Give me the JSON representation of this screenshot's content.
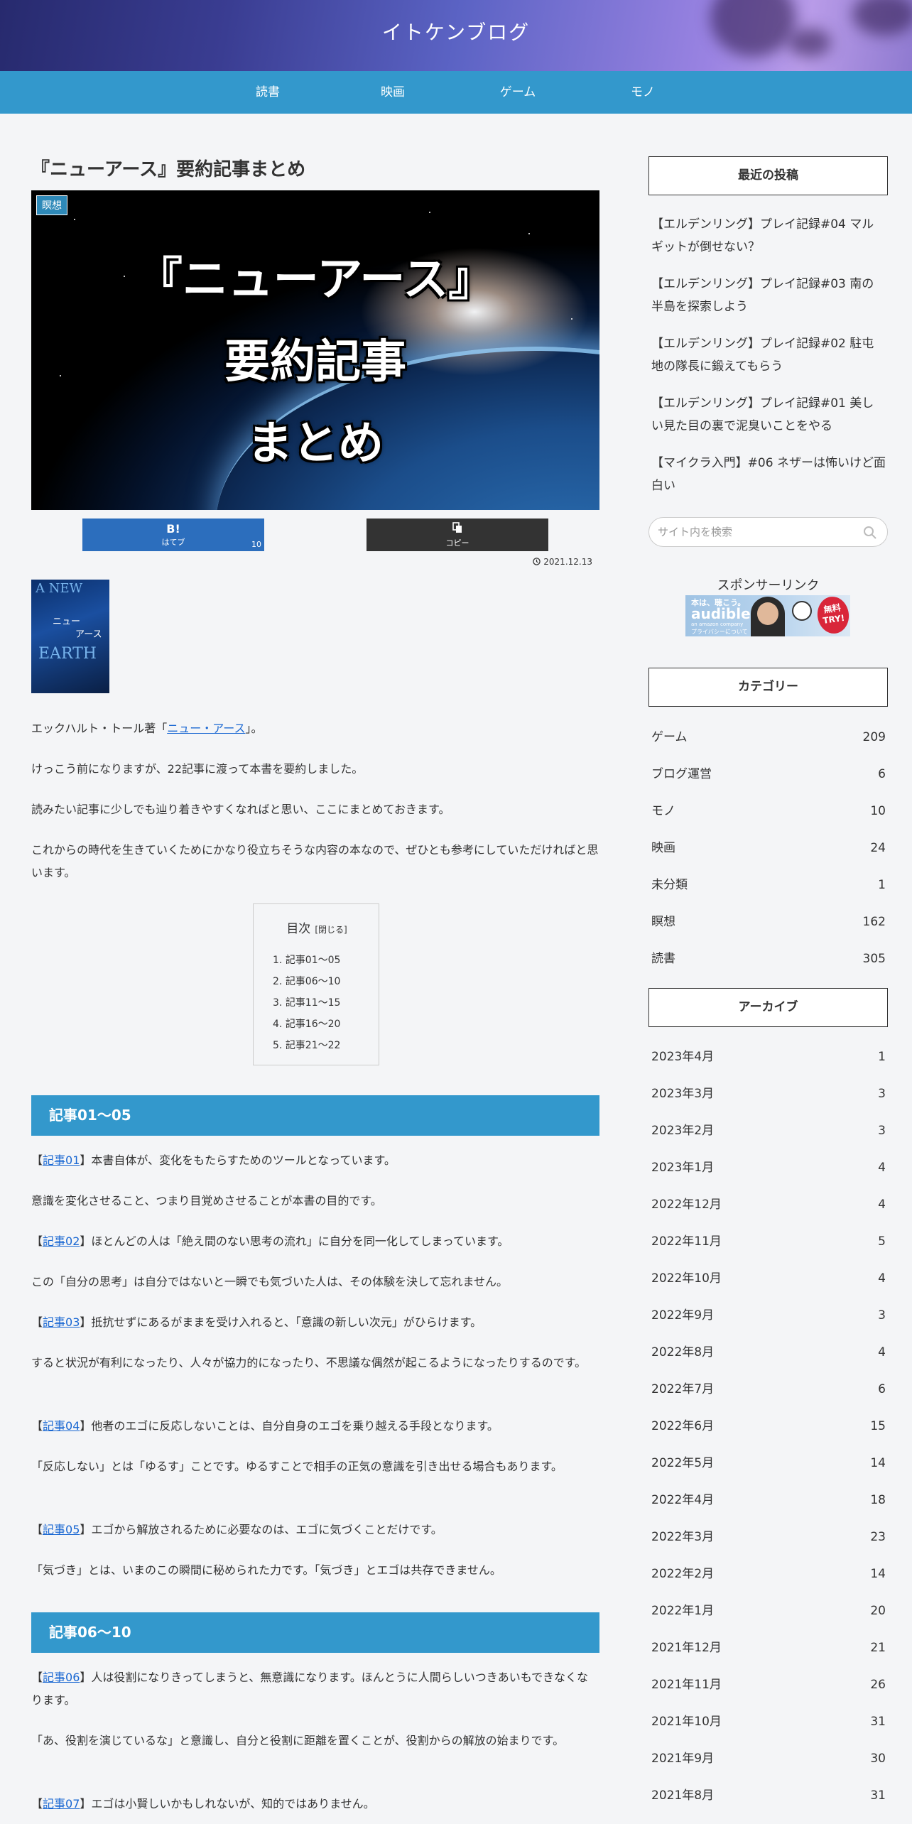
{
  "site": {
    "title": "イトケンブログ"
  },
  "nav": [
    "読書",
    "映画",
    "ゲーム",
    "モノ"
  ],
  "article": {
    "title": "『ニューアース』要約記事まとめ",
    "category": "瞑想",
    "eyecatch_lines": [
      "『ニューアース』",
      "要約記事",
      "まとめ"
    ],
    "share": {
      "hatena_icon": "B!",
      "hatena_label": "はてブ",
      "hatena_count": "10",
      "copy_label": "コピー"
    },
    "date": "2021.12.13",
    "book_cover": {
      "en_top": "A NEW",
      "en_bottom": "EARTH",
      "jp_line1": "ニュー",
      "jp_line2": "アース"
    },
    "intro": {
      "pre": "エックハルト・トール著「",
      "link": "ニュー・アース",
      "post": "」。"
    },
    "paragraphs": [
      "けっこう前になりますが、22記事に渡って本書を要約しました。",
      "読みたい記事に少しでも辿り着きやすくなればと思い、ここにまとめておきます。",
      "これからの時代を生きていくためにかなり役立ちそうな内容の本なので、ぜひとも参考にしていただければと思います。"
    ],
    "toc": {
      "title": "目次",
      "toggle": "[閉じる]",
      "items": [
        "記事01〜05",
        "記事06〜10",
        "記事11〜15",
        "記事16〜20",
        "記事21〜22"
      ]
    },
    "sections": [
      {
        "heading": "記事01〜05",
        "entries": [
          {
            "link": "記事01",
            "text": "本書自体が、変化をもたらすためのツールとなっています。"
          },
          {
            "text": "意識を変化させること、つまり目覚めさせることが本書の目的です。"
          },
          {
            "link": "記事02",
            "text": "ほとんどの人は「絶え間のない思考の流れ」に自分を同一化してしまっています。"
          },
          {
            "text": "この「自分の思考」は自分ではないと一瞬でも気づいた人は、その体験を決して忘れません。"
          },
          {
            "link": "記事03",
            "text": "抵抗せずにあるがままを受け入れると、「意識の新しい次元」がひらけます。"
          },
          {
            "text": "すると状況が有利になったり、人々が協力的になったり、不思議な偶然が起こるようになったりするのです。"
          },
          {
            "link": "記事04",
            "text": "他者のエゴに反応しないことは、自分自身のエゴを乗り越える手段となります。"
          },
          {
            "text": "「反応しない」とは「ゆるす」ことです。ゆるすことで相手の正気の意識を引き出せる場合もあります。"
          },
          {
            "link": "記事05",
            "text": "エゴから解放されるために必要なのは、エゴに気づくことだけです。"
          },
          {
            "text": "「気づき」とは、いまのこの瞬間に秘められた力です。「気づき」とエゴは共存できません。"
          }
        ]
      },
      {
        "heading": "記事06〜10",
        "entries": [
          {
            "link": "記事06",
            "text": "人は役割になりきってしまうと、無意識になります。ほんとうに人間らしいつきあいもできなくなります。"
          },
          {
            "text": "「あ、役割を演じているな」と意識し、自分と役割に距離を置くことが、役割からの解放の始まりです。"
          },
          {
            "link": "記事07",
            "text": "エゴは小賢しいかもしれないが、知的ではありません。"
          }
        ]
      }
    ]
  },
  "sidebar": {
    "recent_title": "最近の投稿",
    "recent_posts": [
      "【エルデンリング】プレイ記録#04 マルギットが倒せない？",
      "【エルデンリング】プレイ記録#03 南の半島を探索しよう",
      "【エルデンリング】プレイ記録#02 駐屯地の隊長に鍛えてもらう",
      "【エルデンリング】プレイ記録#01 美しい見た目の裏で泥臭いことをやる",
      "【マイクラ入門】#06 ネザーは怖いけど面白い"
    ],
    "search_placeholder": "サイト内を検索",
    "sponsor_label": "スポンサーリンク",
    "ad": {
      "tagline": "本は、聴こう。",
      "brand": "audible",
      "sub": "an amazon company",
      "badge_line1": "無料",
      "badge_line2": "TRY!",
      "privacy": "プライバシーについて"
    },
    "category_title": "カテゴリー",
    "categories": [
      {
        "name": "ゲーム",
        "count": "209"
      },
      {
        "name": "ブログ運営",
        "count": "6"
      },
      {
        "name": "モノ",
        "count": "10"
      },
      {
        "name": "映画",
        "count": "24"
      },
      {
        "name": "未分類",
        "count": "1"
      },
      {
        "name": "瞑想",
        "count": "162"
      },
      {
        "name": "読書",
        "count": "305"
      }
    ],
    "archive_title": "アーカイブ",
    "archives": [
      {
        "name": "2023年4月",
        "count": "1"
      },
      {
        "name": "2023年3月",
        "count": "3"
      },
      {
        "name": "2023年2月",
        "count": "3"
      },
      {
        "name": "2023年1月",
        "count": "4"
      },
      {
        "name": "2022年12月",
        "count": "4"
      },
      {
        "name": "2022年11月",
        "count": "5"
      },
      {
        "name": "2022年10月",
        "count": "4"
      },
      {
        "name": "2022年9月",
        "count": "3"
      },
      {
        "name": "2022年8月",
        "count": "4"
      },
      {
        "name": "2022年7月",
        "count": "6"
      },
      {
        "name": "2022年6月",
        "count": "15"
      },
      {
        "name": "2022年5月",
        "count": "14"
      },
      {
        "name": "2022年4月",
        "count": "18"
      },
      {
        "name": "2022年3月",
        "count": "23"
      },
      {
        "name": "2022年2月",
        "count": "14"
      },
      {
        "name": "2022年1月",
        "count": "20"
      },
      {
        "name": "2021年12月",
        "count": "21"
      },
      {
        "name": "2021年11月",
        "count": "26"
      },
      {
        "name": "2021年10月",
        "count": "31"
      },
      {
        "name": "2021年9月",
        "count": "30"
      },
      {
        "name": "2021年8月",
        "count": "31"
      }
    ]
  },
  "colors": {
    "accent": "#3398cc",
    "hatena": "#2c6ebd",
    "copy": "#333333",
    "link": "#1967d2",
    "text": "#333333",
    "bg": "#f4f5f7"
  },
  "icons": {
    "copy": "copy-icon",
    "clock": "clock-icon",
    "search": "search-icon"
  }
}
